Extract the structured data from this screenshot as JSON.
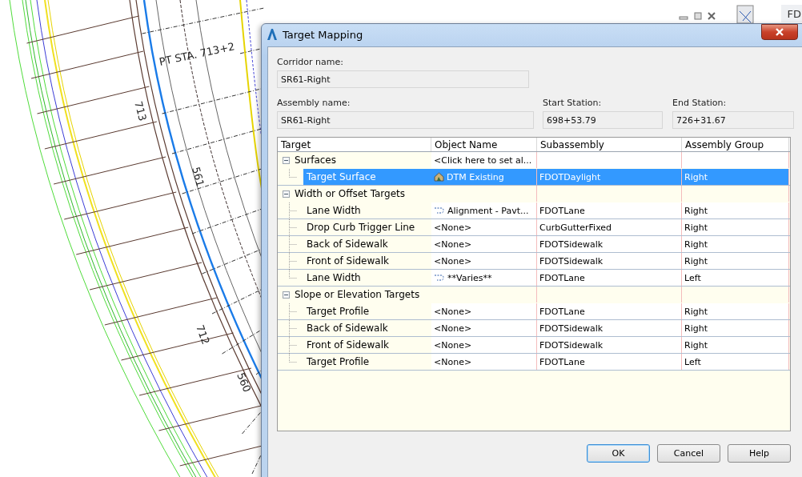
{
  "drawing": {
    "labels": [
      "PT STA. 713+2",
      "713",
      "561",
      "712",
      "560"
    ],
    "corner_label": "FD"
  },
  "dialog": {
    "title": "Target Mapping",
    "corridor": {
      "label": "Corridor name:",
      "value": "SR61-Right"
    },
    "assembly": {
      "label": "Assembly name:",
      "value": "SR61-Right"
    },
    "start_station": {
      "label": "Start Station:",
      "value": "698+53.79"
    },
    "end_station": {
      "label": "End Station:",
      "value": "726+31.67"
    },
    "table": {
      "columns": [
        "Target",
        "Object Name",
        "Subassembly",
        "Assembly Group"
      ],
      "rows": [
        {
          "label": "Surfaces",
          "object_name": "<Click here to set al...",
          "expanded": true,
          "children": [
            {
              "label": "Target Surface",
              "object_name": "DTM Existing",
              "kind": "surface",
              "subassembly": "FDOTDaylight",
              "group": "Right",
              "selected": true
            }
          ]
        },
        {
          "label": "Width or Offset Targets",
          "expanded": true,
          "children": [
            {
              "label": "Lane Width",
              "object_name": "Alignment - Pavt...",
              "kind": "alignment",
              "subassembly": "FDOTLane",
              "group": "Right",
              "selected": false
            },
            {
              "label": "Drop Curb Trigger Line",
              "object_name": "<None>",
              "kind": "plain",
              "subassembly": "CurbGutterFixed",
              "group": "Right",
              "selected": false
            },
            {
              "label": "Back of Sidewalk",
              "object_name": "<None>",
              "kind": "plain",
              "subassembly": "FDOTSidewalk",
              "group": "Right",
              "selected": false
            },
            {
              "label": "Front of Sidewalk",
              "object_name": "<None>",
              "kind": "plain",
              "subassembly": "FDOTSidewalk",
              "group": "Right",
              "selected": false
            },
            {
              "label": "Lane Width",
              "object_name": "**Varies**",
              "kind": "alignment",
              "subassembly": "FDOTLane",
              "group": "Left",
              "selected": false
            }
          ]
        },
        {
          "label": "Slope or Elevation Targets",
          "expanded": true,
          "children": [
            {
              "label": "Target Profile",
              "object_name": "<None>",
              "kind": "plain",
              "subassembly": "FDOTLane",
              "group": "Right",
              "selected": false
            },
            {
              "label": "Back of Sidewalk",
              "object_name": "<None>",
              "kind": "plain",
              "subassembly": "FDOTSidewalk",
              "group": "Right",
              "selected": false
            },
            {
              "label": "Front of Sidewalk",
              "object_name": "<None>",
              "kind": "plain",
              "subassembly": "FDOTSidewalk",
              "group": "Right",
              "selected": false
            },
            {
              "label": "Target Profile",
              "object_name": "<None>",
              "kind": "plain",
              "subassembly": "FDOTLane",
              "group": "Left",
              "selected": false
            }
          ]
        }
      ]
    },
    "buttons": [
      "OK",
      "Cancel",
      "Help"
    ]
  }
}
